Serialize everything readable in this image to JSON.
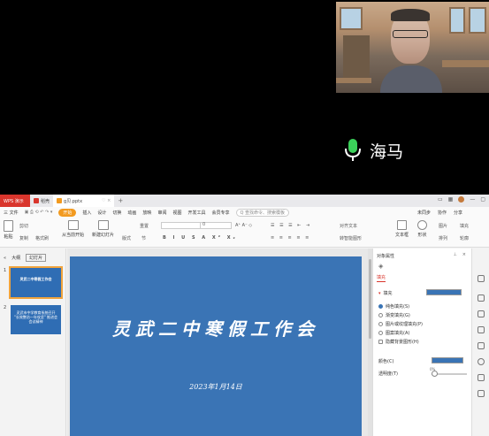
{
  "caller": {
    "name": "海马"
  },
  "tabs": {
    "wps": "WPS 演示",
    "doc1": "稻壳",
    "doc2": "g贝.pptx",
    "plus": "+"
  },
  "menu": {
    "file": "三 文件",
    "items": [
      "开始",
      "插入",
      "设计",
      "切换",
      "动画",
      "放映",
      "审阅",
      "视图",
      "开发工具",
      "会员专享"
    ],
    "search": "Q 查找命令、搜索模板",
    "sync": "未同步",
    "collab": "协作",
    "share": "分享"
  },
  "ribbon": {
    "paste": "粘贴",
    "cut": "剪切",
    "copy": "复制",
    "format_painter": "格式刷",
    "start_from": "从当前开始",
    "new_slide": "新建幻灯片",
    "layout": "版式",
    "section": "节",
    "reset": "重置",
    "font_size": "0",
    "textbox": "文本框",
    "shape": "形状",
    "arrange": "排列",
    "picture": "图片",
    "fill": "填充",
    "outline": "轮廓",
    "align_text": "对齐文本",
    "smart_art": "转智能图形"
  },
  "left_panel": {
    "tab_outline": "大纲",
    "tab_slides": "幻灯片",
    "slides": [
      {
        "num": "1",
        "text": "灵武二中寒假工作会"
      },
      {
        "num": "2",
        "text": "灵武市中学教育系统召开 \"长效整治一年攻坚\" 推进会 会议精神"
      }
    ]
  },
  "slide": {
    "title": "灵武二中寒假工作会",
    "date": "2023年1月14日"
  },
  "right_panel": {
    "header": "对象属性",
    "tab": "填充",
    "fill_label": "填充",
    "options": [
      "纯色填充(S)",
      "渐变填充(G)",
      "图片或纹理填充(P)",
      "图案填充(A)",
      "隐藏背景图形(H)"
    ],
    "color_label": "颜色(C)",
    "transparency_label": "透明度(T)",
    "transparency_value": "0%"
  },
  "colors": {
    "slide_bg": "#3a74b5",
    "accent": "#d9352c",
    "start_tab": "#f29a1f"
  }
}
